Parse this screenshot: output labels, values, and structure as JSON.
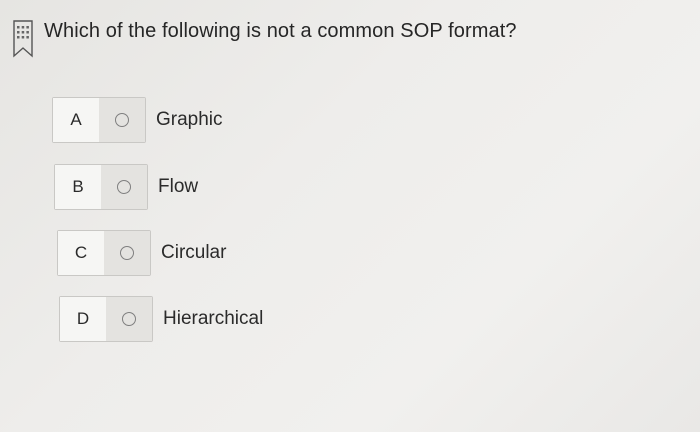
{
  "question": {
    "text": "Which of the following is not a common SOP format?",
    "icon": "bookmark-icon"
  },
  "options": [
    {
      "letter": "A",
      "label": "Graphic"
    },
    {
      "letter": "B",
      "label": "Flow"
    },
    {
      "letter": "C",
      "label": "Circular"
    },
    {
      "letter": "D",
      "label": "Hierarchical"
    }
  ]
}
